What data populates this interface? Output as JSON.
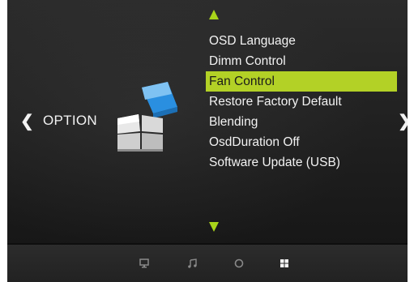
{
  "nav": {
    "left_arrow": "❮",
    "right_arrow": "❯"
  },
  "section": {
    "title": "OPTION"
  },
  "menu": {
    "items": [
      {
        "label": "OSD Language"
      },
      {
        "label": "Dimm Control"
      },
      {
        "label": "Fan Control"
      },
      {
        "label": "Restore Factory Default"
      },
      {
        "label": "Blending"
      },
      {
        "label": "OsdDuration Off"
      },
      {
        "label": "Software Update (USB)"
      }
    ],
    "selected_label": "Fan Control"
  },
  "bottom_bar": {
    "icons": [
      "monitor-icon",
      "music-note-icon",
      "circle-icon",
      "grid-icon"
    ],
    "active_icon": "grid-icon"
  },
  "colors": {
    "accent": "#b3d126",
    "text": "#f2f2f2",
    "background": "#1e1e1e"
  }
}
